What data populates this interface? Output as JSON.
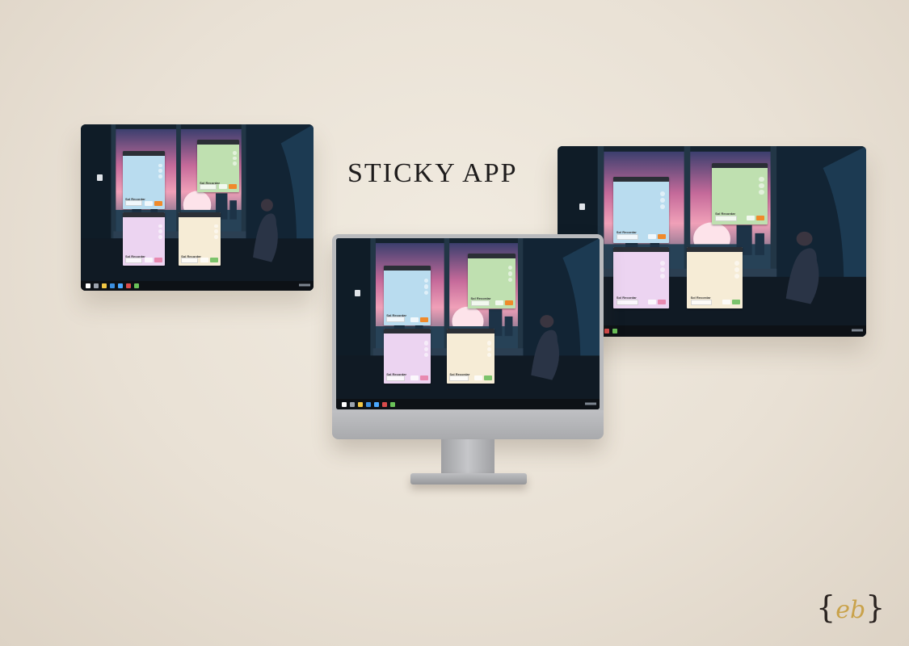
{
  "title": "STICKY APP",
  "logo": {
    "open": "{",
    "mark": "eb",
    "close": "}"
  },
  "colors": {
    "background": "#ebe4d8",
    "note_blue": "#b9dcef",
    "note_green": "#bfe0b0",
    "note_pink": "#ecd4f1",
    "note_cream": "#f6ecd6",
    "button_orange": "#f08a2a",
    "button_pink": "#e88ab0",
    "button_green": "#7cc36b"
  },
  "desktop": {
    "taskbar_icons": [
      "start-icon",
      "search-icon",
      "folder-icon",
      "browser-icon",
      "mail-icon",
      "store-icon",
      "sticky-app-icon"
    ],
    "notes": [
      {
        "color": "note_blue",
        "name": "Sol Recordar"
      },
      {
        "color": "note_green",
        "name": "Sol Recordar"
      },
      {
        "color": "note_pink",
        "name": "Sol Recordar"
      },
      {
        "color": "note_cream",
        "name": "Sol Recordar"
      }
    ]
  }
}
